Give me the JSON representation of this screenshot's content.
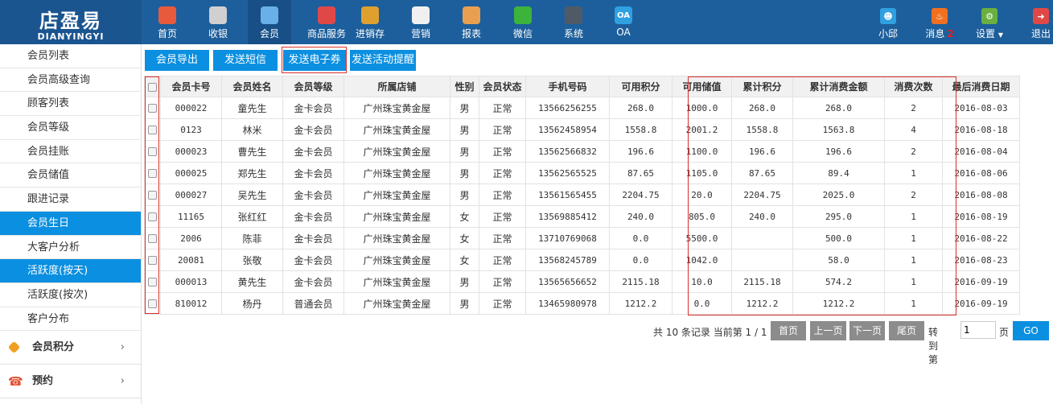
{
  "logo": {
    "main": "店盈易",
    "sub": "DIANYINGYI"
  },
  "nav": [
    {
      "label": "首页",
      "icon": "home-icon",
      "color": "#e85a3c"
    },
    {
      "label": "收银",
      "icon": "cash-register-icon",
      "color": "#d0d0d0"
    },
    {
      "label": "会员",
      "icon": "member-icon",
      "color": "#6ab0e8"
    },
    {
      "label": "商品服务",
      "icon": "goods-icon",
      "color": "#e04848"
    },
    {
      "label": "进销存",
      "icon": "inventory-icon",
      "color": "#e0a030"
    },
    {
      "label": "营销",
      "icon": "megaphone-icon",
      "color": "#f0f0f0"
    },
    {
      "label": "报表",
      "icon": "report-icon",
      "color": "#e8a050"
    },
    {
      "label": "微信",
      "icon": "wechat-icon",
      "color": "#3cb43c"
    },
    {
      "label": "系统",
      "icon": "monitor-icon",
      "color": "#505a66"
    },
    {
      "label": "OA",
      "icon": "oa-icon",
      "color": "#2fa0e0",
      "glyph": "OA"
    }
  ],
  "user_nav": {
    "user": {
      "label": "小邱",
      "icon": "user-icon",
      "color": "#2fa0e0"
    },
    "messages": {
      "label": "消息",
      "count": "2",
      "icon": "bell-icon",
      "color": "#f07020"
    },
    "settings": {
      "label": "设置",
      "icon": "settings-icon",
      "color": "#6ab040"
    },
    "logout": {
      "label": "退出",
      "icon": "logout-icon",
      "color": "#e04848"
    }
  },
  "sidebar": {
    "items": [
      {
        "label": "会员列表",
        "active": false
      },
      {
        "label": "会员高级查询",
        "active": false
      },
      {
        "label": "顾客列表",
        "active": false
      },
      {
        "label": "会员等级",
        "active": false
      },
      {
        "label": "会员挂账",
        "active": false
      },
      {
        "label": "会员储值",
        "active": false
      },
      {
        "label": "跟进记录",
        "active": false
      },
      {
        "label": "会员生日",
        "active": true
      },
      {
        "label": "大客户分析",
        "active": false
      },
      {
        "label": "活跃度(按天)",
        "active": true
      },
      {
        "label": "活跃度(按次)",
        "active": false
      },
      {
        "label": "客户分布",
        "active": false
      }
    ],
    "groups": [
      {
        "label": "会员积分",
        "icon": "tag-icon",
        "color": "#f0a020"
      },
      {
        "label": "预约",
        "icon": "phone-icon",
        "color": "#e05030"
      }
    ]
  },
  "toolbar": {
    "buttons": [
      "会员导出",
      "发送短信",
      "发送电子券",
      "发送活动提醒"
    ]
  },
  "table": {
    "columns": [
      "会员卡号",
      "会员姓名",
      "会员等级",
      "所属店铺",
      "性别",
      "会员状态",
      "手机号码",
      "可用积分",
      "可用储值",
      "累计积分",
      "累计消费金额",
      "消费次数",
      "最后消费日期"
    ],
    "rows": [
      [
        "000022",
        "童先生",
        "金卡会员",
        "广州珠宝黄金屋",
        "男",
        "正常",
        "13566256255",
        "268.0",
        "1000.0",
        "268.0",
        "268.0",
        "2",
        "2016-08-03"
      ],
      [
        "0123",
        "林米",
        "金卡会员",
        "广州珠宝黄金屋",
        "男",
        "正常",
        "13562458954",
        "1558.8",
        "2001.2",
        "1558.8",
        "1563.8",
        "4",
        "2016-08-18"
      ],
      [
        "000023",
        "曹先生",
        "金卡会员",
        "广州珠宝黄金屋",
        "男",
        "正常",
        "13562566832",
        "196.6",
        "1100.0",
        "196.6",
        "196.6",
        "2",
        "2016-08-04"
      ],
      [
        "000025",
        "郑先生",
        "金卡会员",
        "广州珠宝黄金屋",
        "男",
        "正常",
        "13562565525",
        "87.65",
        "1105.0",
        "87.65",
        "89.4",
        "1",
        "2016-08-06"
      ],
      [
        "000027",
        "吴先生",
        "金卡会员",
        "广州珠宝黄金屋",
        "男",
        "正常",
        "13561565455",
        "2204.75",
        "20.0",
        "2204.75",
        "2025.0",
        "2",
        "2016-08-08"
      ],
      [
        "11165",
        "张红红",
        "金卡会员",
        "广州珠宝黄金屋",
        "女",
        "正常",
        "13569885412",
        "240.0",
        "805.0",
        "240.0",
        "295.0",
        "1",
        "2016-08-19"
      ],
      [
        "2006",
        "陈菲",
        "金卡会员",
        "广州珠宝黄金屋",
        "女",
        "正常",
        "13710769068",
        "0.0",
        "5500.0",
        "",
        "500.0",
        "1",
        "2016-08-22"
      ],
      [
        "20081",
        "张敬",
        "金卡会员",
        "广州珠宝黄金屋",
        "女",
        "正常",
        "13568245789",
        "0.0",
        "1042.0",
        "",
        "58.0",
        "1",
        "2016-08-23"
      ],
      [
        "000013",
        "黄先生",
        "金卡会员",
        "广州珠宝黄金屋",
        "男",
        "正常",
        "13565656652",
        "2115.18",
        "10.0",
        "2115.18",
        "574.2",
        "1",
        "2016-09-19"
      ],
      [
        "810012",
        "杨丹",
        "普通会员",
        "广州珠宝黄金屋",
        "男",
        "正常",
        "13465980978",
        "1212.2",
        "0.0",
        "1212.2",
        "1212.2",
        "1",
        "2016-09-19"
      ]
    ]
  },
  "pager": {
    "summary": "共 10 条记录 当前第 1 / 1",
    "first": "首页",
    "prev": "上一页",
    "next": "下一页",
    "last": "尾页",
    "goto_label": "转到第",
    "goto_value": "1",
    "page_unit": "页",
    "go": "GO"
  },
  "colors": {
    "topbar": "#1d5f9c",
    "accent": "#0b8fe0",
    "highlight_box": "#d9302c"
  }
}
